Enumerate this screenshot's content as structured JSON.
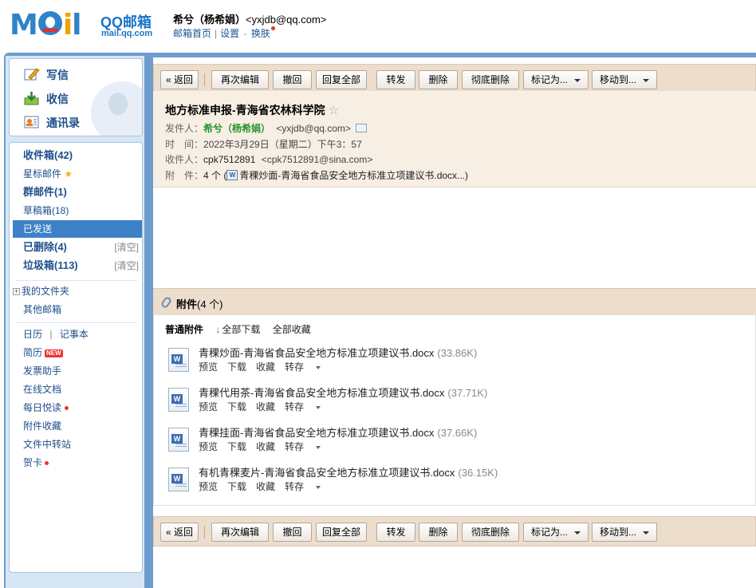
{
  "brand": {
    "logo_word": "MAIL",
    "product": "QQ邮箱",
    "url": "mail.qq.com"
  },
  "user": {
    "name": "希兮（杨希娟）",
    "email": "<yxjdb@qq.com>",
    "links": {
      "home": "邮箱首页",
      "settings": "设置",
      "dash": "-",
      "skin": "换肤"
    }
  },
  "sidebar": {
    "compose": "写信",
    "receive": "收信",
    "contacts": "通讯录",
    "folders": [
      {
        "label": "收件箱(42)"
      },
      {
        "label": "星标邮件"
      },
      {
        "label": "群邮件(1)"
      },
      {
        "label": "草稿箱(18)"
      },
      {
        "label": "已发送"
      },
      {
        "label": "已删除(4)",
        "action": "[清空]"
      },
      {
        "label": "垃圾箱(113)",
        "action": "[清空]"
      }
    ],
    "my_folders": "我的文件夹",
    "other_mailboxes": "其他邮箱",
    "calendar": "日历",
    "notes": "记事本",
    "apps": [
      {
        "label": "简历",
        "badge": "NEW"
      },
      {
        "label": "发票助手"
      },
      {
        "label": "在线文档"
      },
      {
        "label": "每日悦读"
      },
      {
        "label": "附件收藏"
      },
      {
        "label": "文件中转站"
      },
      {
        "label": "贺卡"
      }
    ],
    "calendar_sep": "|"
  },
  "toolbar": {
    "back": "« 返回",
    "reedit": "再次编辑",
    "recall": "撤回",
    "reply_all": "回复全部",
    "forward": "转发",
    "delete": "删除",
    "delete_forever": "彻底删除",
    "mark_as": "标记为...",
    "move_to": "移动到..."
  },
  "message": {
    "subject": "地方标准申报-青海省农林科学院",
    "star": "☆",
    "from_label": "发件人：",
    "from_name": "希兮（杨希娟）",
    "from_email": "<yxjdb@qq.com>",
    "time_label": "时　间：",
    "time_value": "2022年3月29日（星期二）下午3：57",
    "to_label": "收件人：",
    "to_name": "cpk7512891",
    "to_email": "<cpk7512891@sina.com>",
    "att_label": "附　件：",
    "att_count": "4 个",
    "att_open_paren": "(",
    "att_preview": "青稞炒面-青海省食品安全地方标准立项建议书.docx...)",
    "doc_icon_letter": "W"
  },
  "attachments": {
    "title": "附件",
    "count": "(4 个)",
    "normal_label": "普通附件",
    "download_all": "全部下载",
    "save_all": "全部收藏",
    "download_arrow": "↓",
    "actions": {
      "preview": "预览",
      "download": "下载",
      "save": "收藏",
      "transfer": "转存"
    },
    "items": [
      {
        "name": "青稞炒面-青海省食品安全地方标准立项建议书.docx",
        "size": "(33.86K)"
      },
      {
        "name": "青稞代用茶-青海省食品安全地方标准立项建议书.docx",
        "size": "(37.71K)"
      },
      {
        "name": "青稞挂面-青海省食品安全地方标准立项建议书.docx",
        "size": "(37.66K)"
      },
      {
        "name": "有机青稞麦片-青海省食品安全地方标准立项建议书.docx",
        "size": "(36.15K)"
      }
    ]
  },
  "colors": {
    "brand_blue": "#2f83c8",
    "selected_folder": "#3d82c6",
    "toolbar_bg": "#ecddcc",
    "sender_green": "#27922f",
    "notify_red": "#ee3333"
  }
}
